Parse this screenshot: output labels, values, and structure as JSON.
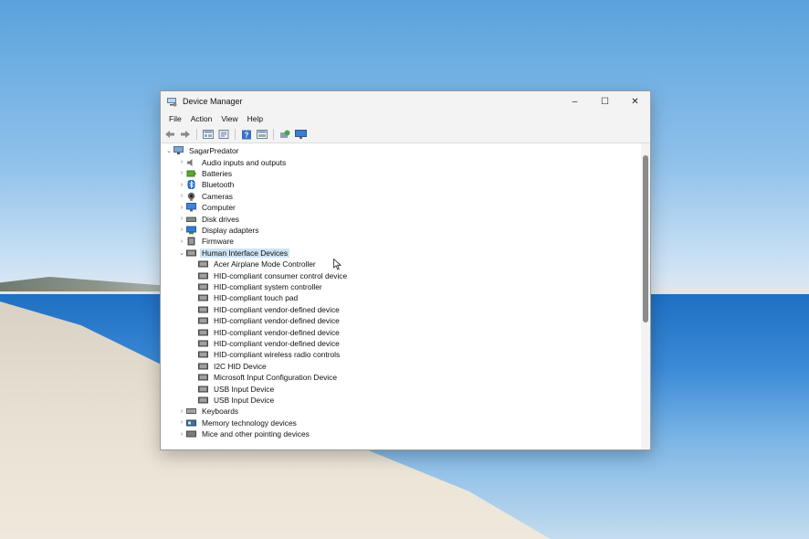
{
  "window": {
    "title": "Device Manager",
    "controls": {
      "minimize": "–",
      "maximize": "☐",
      "close": "✕"
    }
  },
  "menu": [
    "File",
    "Action",
    "View",
    "Help"
  ],
  "toolbar_icons": [
    "back-icon",
    "forward-icon",
    "properties-icon",
    "update-driver-icon",
    "help-icon",
    "view-icon",
    "scan-hardware-icon",
    "monitor-icon"
  ],
  "tree": {
    "root": "SagarPredator",
    "categories": [
      {
        "label": "Audio inputs and outputs",
        "icon": "speaker-icon",
        "expanded": false
      },
      {
        "label": "Batteries",
        "icon": "battery-icon",
        "expanded": false
      },
      {
        "label": "Bluetooth",
        "icon": "bluetooth-icon",
        "expanded": false
      },
      {
        "label": "Cameras",
        "icon": "camera-icon",
        "expanded": false
      },
      {
        "label": "Computer",
        "icon": "computer-icon",
        "expanded": false
      },
      {
        "label": "Disk drives",
        "icon": "disk-icon",
        "expanded": false
      },
      {
        "label": "Display adapters",
        "icon": "display-icon",
        "expanded": false
      },
      {
        "label": "Firmware",
        "icon": "firmware-icon",
        "expanded": false
      },
      {
        "label": "Human Interface Devices",
        "icon": "hid-icon",
        "expanded": true,
        "selected": true,
        "children": [
          "Acer Airplane Mode Controller",
          "HID-compliant consumer control device",
          "HID-compliant system controller",
          "HID-compliant touch pad",
          "HID-compliant vendor-defined device",
          "HID-compliant vendor-defined device",
          "HID-compliant vendor-defined device",
          "HID-compliant vendor-defined device",
          "HID-compliant wireless radio controls",
          "I2C HID Device",
          "Microsoft Input Configuration Device",
          "USB Input Device",
          "USB Input Device"
        ]
      },
      {
        "label": "Keyboards",
        "icon": "keyboard-icon",
        "expanded": false
      },
      {
        "label": "Memory technology devices",
        "icon": "memory-icon",
        "expanded": false
      },
      {
        "label": "Mice and other pointing devices",
        "icon": "mouse-icon",
        "expanded": false
      }
    ]
  },
  "colors": {
    "selection": "#cce4f7",
    "chrome": "#f3f3f3"
  }
}
